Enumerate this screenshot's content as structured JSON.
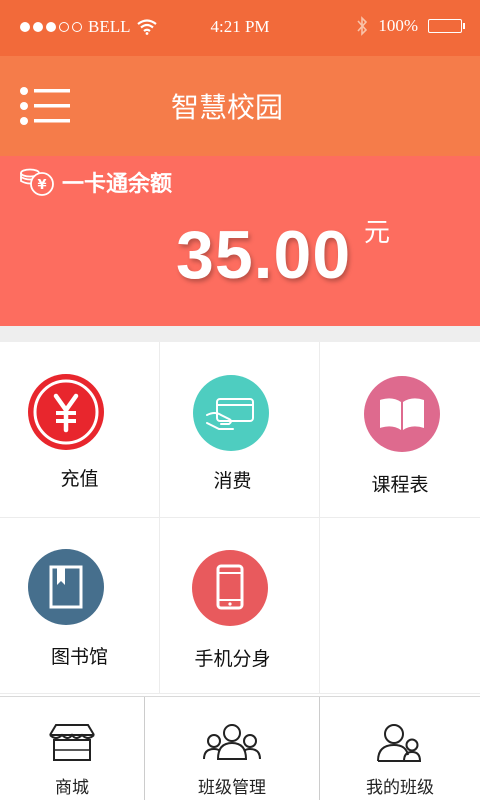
{
  "status_bar": {
    "carrier": "BELL",
    "time": "4:21 PM",
    "battery_text": "100%"
  },
  "header": {
    "title": "智慧校园"
  },
  "balance": {
    "label": "一卡通余额",
    "amount": "35.00",
    "unit": "元"
  },
  "grid": {
    "items": [
      {
        "label": "充值",
        "icon": "yen-icon",
        "color": "#e8262d"
      },
      {
        "label": "消费",
        "icon": "card-icon",
        "color": "#4ecdc0"
      },
      {
        "label": "课程表",
        "icon": "book-open-icon",
        "color": "#de6a8e"
      },
      {
        "label": "图书馆",
        "icon": "library-book-icon",
        "color": "#466f8d"
      },
      {
        "label": "手机分身",
        "icon": "phone-icon",
        "color": "#e85a5d"
      }
    ]
  },
  "tabbar": {
    "items": [
      {
        "label": "商城",
        "icon": "store-icon"
      },
      {
        "label": "班级管理",
        "icon": "group-icon"
      },
      {
        "label": "我的班级",
        "icon": "users-icon"
      }
    ]
  },
  "colors": {
    "status_bar": "#f26a3a",
    "nav_bar": "#f57c4a",
    "balance_bg": "#fd6d5f"
  }
}
